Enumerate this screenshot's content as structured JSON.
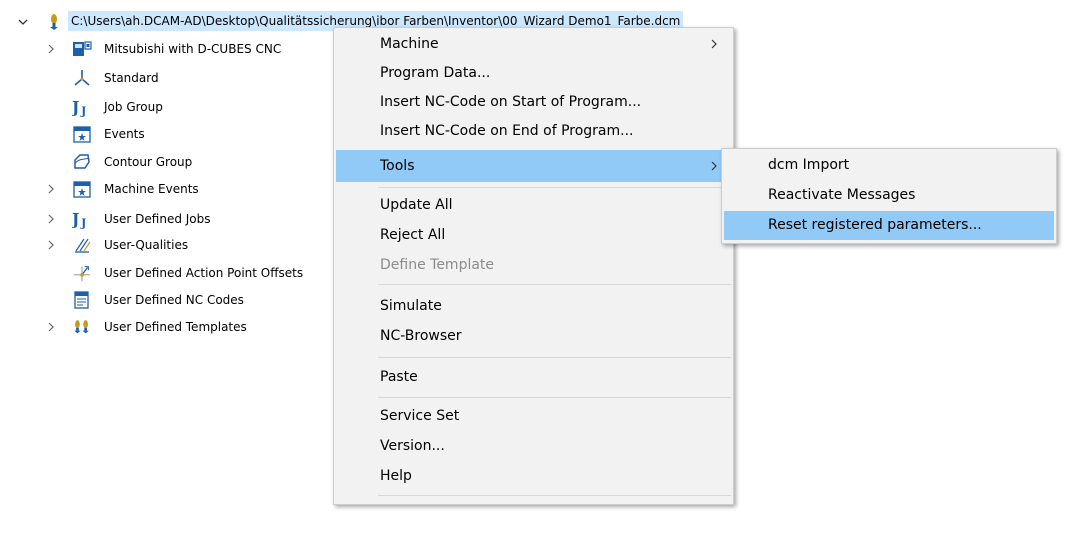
{
  "tree": {
    "root": {
      "label": "C:\\Users\\ah.DCAM-AD\\Desktop\\Qualitätssicherung\\ibor Farben\\Inventor\\00_Wizard Demo1_Farbe.dcm"
    },
    "items": [
      {
        "label": "Mitsubishi with D-CUBES CNC",
        "icon": "machine-icon",
        "expandable": true
      },
      {
        "label": "Standard",
        "icon": "coordinate-axes-icon",
        "expandable": false
      },
      {
        "label": "Job Group",
        "icon": "job-icon",
        "expandable": false
      },
      {
        "label": "Events",
        "icon": "events-icon",
        "expandable": false
      },
      {
        "label": "Contour Group",
        "icon": "contour-icon",
        "expandable": false
      },
      {
        "label": "Machine Events",
        "icon": "events-icon",
        "expandable": true
      },
      {
        "label": "User Defined Jobs",
        "icon": "job-icon",
        "expandable": true
      },
      {
        "label": "User-Qualities",
        "icon": "qualities-icon",
        "expandable": true
      },
      {
        "label": "User Defined Action Point Offsets",
        "icon": "action-point-icon",
        "expandable": false
      },
      {
        "label": "User Defined NC Codes",
        "icon": "nc-code-icon",
        "expandable": false
      },
      {
        "label": "User Defined Templates",
        "icon": "templates-icon",
        "expandable": true
      }
    ]
  },
  "context_menu": {
    "items": [
      {
        "label": "Machine",
        "submenu": true
      },
      {
        "label": "Program Data..."
      },
      {
        "label": "Insert NC-Code on Start of Program..."
      },
      {
        "label": "Insert NC-Code on End of Program..."
      },
      {
        "label": "Tools",
        "submenu": true,
        "highlighted": true
      },
      {
        "label": "Update All"
      },
      {
        "label": "Reject All"
      },
      {
        "label": "Define Template",
        "disabled": true
      },
      {
        "label": "Simulate"
      },
      {
        "label": "NC-Browser"
      },
      {
        "label": "Paste"
      },
      {
        "label": "Service Set"
      },
      {
        "label": "Version..."
      },
      {
        "label": "Help"
      }
    ]
  },
  "tools_submenu": {
    "items": [
      {
        "label": "dcm Import"
      },
      {
        "label": "Reactivate Messages"
      },
      {
        "label": "Reset registered parameters...",
        "highlighted": true
      }
    ]
  },
  "colors": {
    "selection": "#cce8ff",
    "menu_highlight": "#91c9f7",
    "menu_bg": "#f2f2f2",
    "icon_blue": "#1d5fa8",
    "icon_gold": "#c89b1c"
  }
}
